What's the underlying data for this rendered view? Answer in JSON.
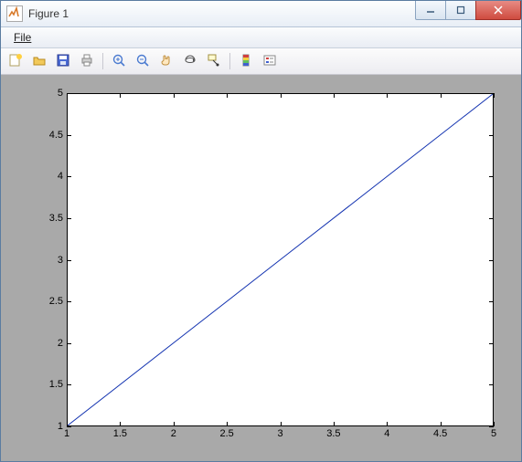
{
  "window": {
    "title": "Figure 1"
  },
  "menubar": {
    "file": "File"
  },
  "toolbar_icons": {
    "new": "new-figure-icon",
    "open": "open-icon",
    "save": "save-icon",
    "print": "print-icon",
    "zoom_in": "zoom-in-icon",
    "zoom_out": "zoom-out-icon",
    "pan": "pan-icon",
    "rotate": "rotate-3d-icon",
    "data_cursor": "data-cursor-icon",
    "insert_colorbar": "colorbar-icon",
    "insert_legend": "legend-icon"
  },
  "chart_data": {
    "type": "line",
    "x": [
      1,
      2,
      3,
      4,
      5
    ],
    "y": [
      1,
      2,
      3,
      4,
      5
    ],
    "xlim": [
      1,
      5
    ],
    "ylim": [
      1,
      5
    ],
    "xticks": [
      1,
      1.5,
      2,
      2.5,
      3,
      3.5,
      4,
      4.5,
      5
    ],
    "yticks": [
      1,
      1.5,
      2,
      2.5,
      3,
      3.5,
      4,
      4.5,
      5
    ],
    "xtick_labels": [
      "1",
      "1.5",
      "2",
      "2.5",
      "3",
      "3.5",
      "4",
      "4.5",
      "5"
    ],
    "ytick_labels": [
      "1",
      "1.5",
      "2",
      "2.5",
      "3",
      "3.5",
      "4",
      "4.5",
      "5"
    ],
    "line_color": "#1232b0",
    "grid": false,
    "title": "",
    "xlabel": "",
    "ylabel": ""
  }
}
